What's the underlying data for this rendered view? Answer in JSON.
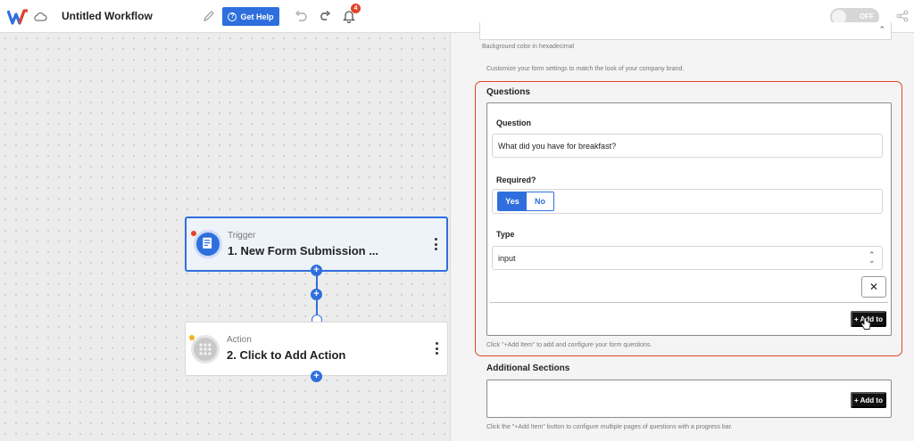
{
  "app": {
    "title": "Untitled Workflow",
    "get_help_label": "Get Help",
    "notification_count": "4",
    "toggle_label": "OFF"
  },
  "icons": {
    "logo": "logo-icon",
    "cloud": "cloud-icon",
    "edit": "pencil-icon",
    "help": "question-circle-icon",
    "undo": "undo-icon",
    "redo": "redo-icon",
    "notifications": "bell-icon",
    "share": "share-icon",
    "trigger": "form-document-icon",
    "action": "grid-apps-icon",
    "remove": "close-icon",
    "cursor": "hand-pointer-icon"
  },
  "canvas": {
    "trigger": {
      "kind": "Trigger",
      "name": "1. New Form Submission ..."
    },
    "action": {
      "kind": "Action",
      "name": "2. Click to Add Action"
    }
  },
  "panel": {
    "bg_hint": "Background color in hexadecimal",
    "customize_hint": "Customize your form settings to match the look of your company brand.",
    "questions": {
      "title": "Questions",
      "question_label": "Question",
      "question_value": "What did you have for breakfast?",
      "required_label": "Required?",
      "required_yes": "Yes",
      "required_no": "No",
      "type_label": "Type",
      "type_value": "input",
      "remove_label": "✕",
      "add_button": "+ Add to",
      "hint": "Click \"+Add Item\" to add and configure your form questions."
    },
    "additional": {
      "title": "Additional Sections",
      "add_button": "+ Add to",
      "hint": "Click the \"+Add Item\" button to configure multiple pages of questions with a progress bar."
    }
  },
  "colors": {
    "accent": "#2f6fdd",
    "highlight_border": "#e0442a",
    "badge": "#e0442a"
  }
}
